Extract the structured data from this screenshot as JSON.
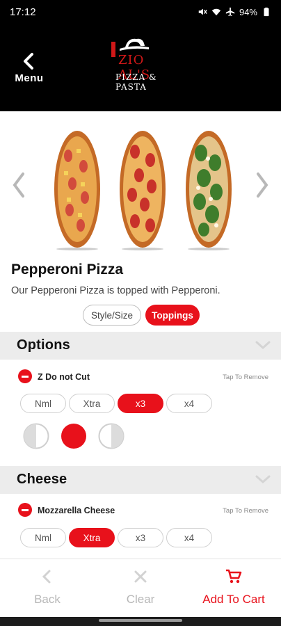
{
  "status_bar": {
    "time": "17:12",
    "battery": "94%"
  },
  "header": {
    "menu_label": "Menu",
    "logo_name": "ZIO AL'S",
    "logo_subtitle": "PIZZA & PASTA"
  },
  "carousel": {
    "images": [
      "hawaiian-pizza",
      "pepperoni-pizza",
      "spinach-pizza"
    ]
  },
  "product": {
    "title": "Pepperoni Pizza",
    "description": "Our Pepperoni Pizza is topped with Pepperoni."
  },
  "segments": {
    "style_size": "Style/Size",
    "toppings": "Toppings",
    "selected": "Toppings"
  },
  "sections": [
    {
      "title": "Options",
      "item": {
        "name": "Z Do not Cut",
        "tap_to_remove": "Tap To Remove",
        "quantities": [
          "Nml",
          "Xtra",
          "x3",
          "x4"
        ],
        "selected_quantity": "x3",
        "placement": [
          "left-half",
          "whole",
          "right-half"
        ],
        "selected_placement": "whole"
      }
    },
    {
      "title": "Cheese",
      "item": {
        "name": "Mozzarella Cheese",
        "tap_to_remove": "Tap To Remove",
        "quantities": [
          "Nml",
          "Xtra",
          "x3",
          "x4"
        ],
        "selected_quantity": "Xtra"
      }
    }
  ],
  "bottom_bar": {
    "back": "Back",
    "clear": "Clear",
    "add_to_cart": "Add To Cart"
  },
  "colors": {
    "accent": "#e8111b",
    "header_bg": "#000000",
    "section_bg": "#ececec"
  }
}
